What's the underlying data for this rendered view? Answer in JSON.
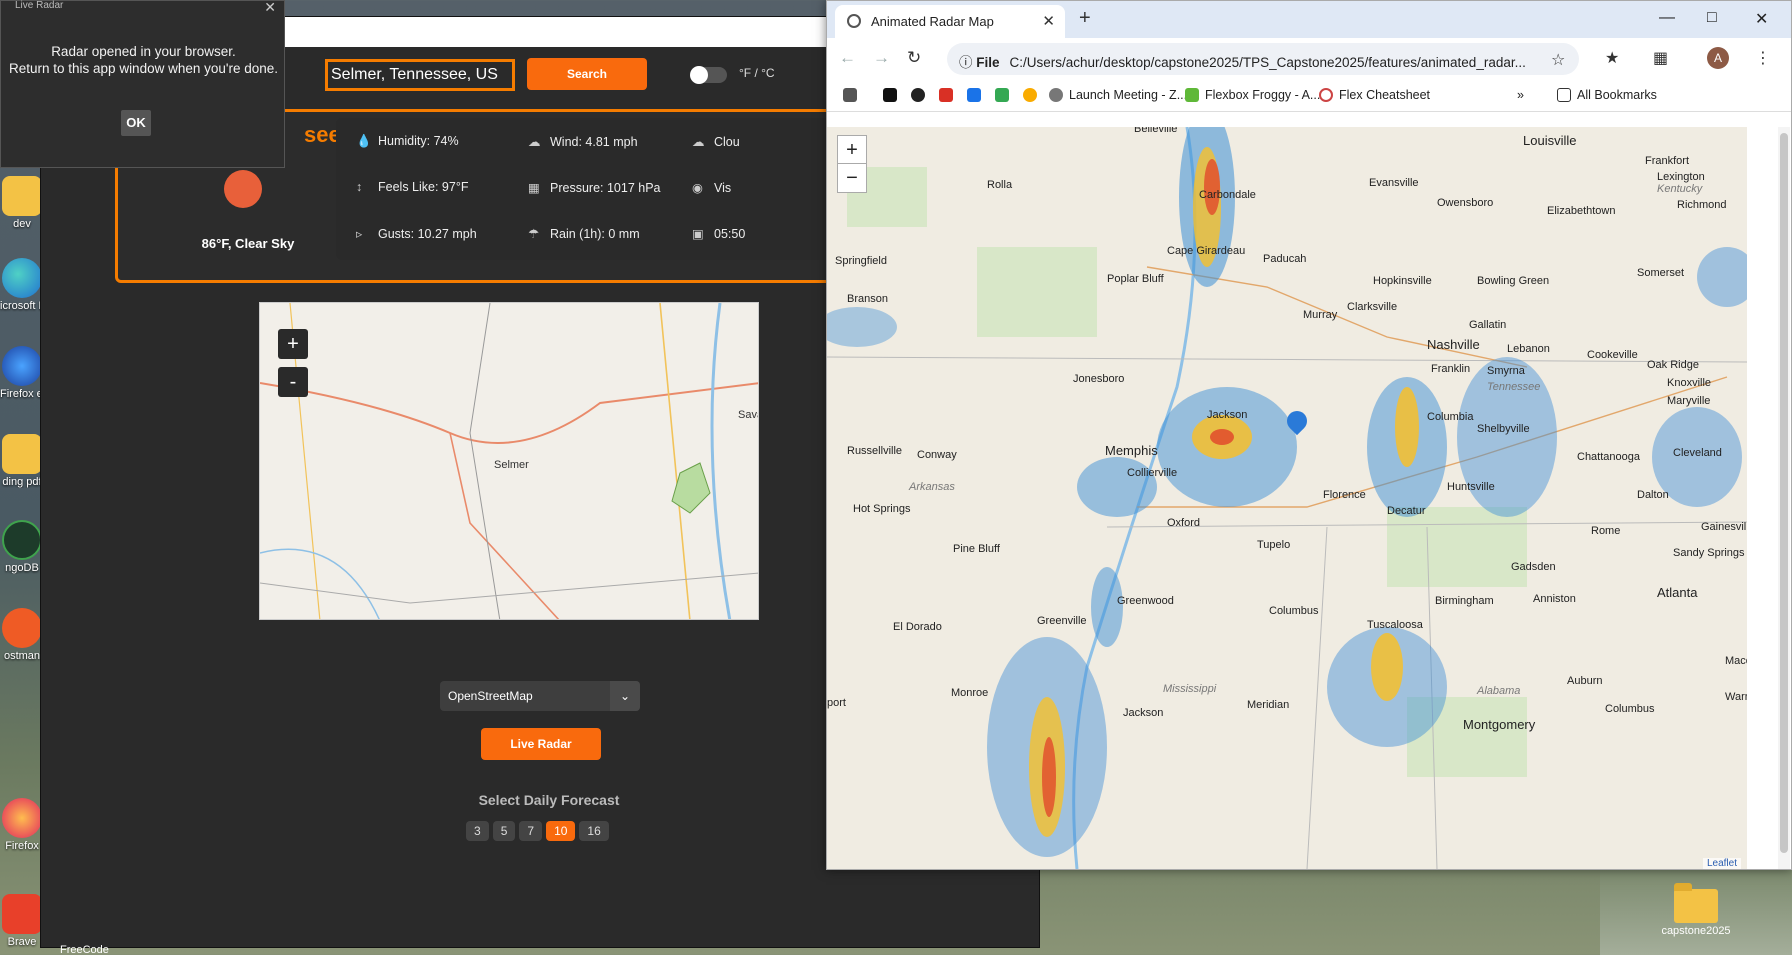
{
  "desktop": {
    "icons": [
      {
        "label": "dev"
      },
      {
        "label": "icrosoft Edge"
      },
      {
        "label": "Firefox evelop..."
      },
      {
        "label": "ding pdf"
      },
      {
        "label": "ngoDB"
      },
      {
        "label": "ostman"
      },
      {
        "label": "Firefox"
      },
      {
        "label": "Brave"
      }
    ],
    "taskbar_label": "FreeCode",
    "folder_label": "capstone2025"
  },
  "dialog": {
    "title": "Live Radar",
    "message_line1": "Radar opened in your browser.",
    "message_line2": "Return to this app window when you're done.",
    "ok_label": "OK"
  },
  "app": {
    "search_value": "Selmer, Tennessee, US",
    "search_button": "Search",
    "unit_toggle_label": "°F / °C",
    "city_name": "see, US",
    "temp_summary": "86°F, Clear Sky",
    "details": {
      "humidity": "Humidity: 74%",
      "wind": "Wind: 4.81 mph",
      "clouds": "Clou",
      "feels_like": "Feels Like: 97°F",
      "pressure": "Pressure: 1017 hPa",
      "visibility": "Vis",
      "gusts": "Gusts: 10.27 mph",
      "rain": "Rain (1h): 0 mm",
      "time": "05:50"
    },
    "map": {
      "zoom_in": "+",
      "zoom_out": "-",
      "labels": {
        "selmer": "Selmer",
        "sava": "Sava"
      }
    },
    "layer_select": "OpenStreetMap",
    "radar_button": "Live Radar",
    "forecast_title": "Select Daily Forecast",
    "forecast_days": [
      "3",
      "5",
      "7",
      "10",
      "16"
    ],
    "forecast_active": "10"
  },
  "browser": {
    "tab_title": "Animated Radar Map",
    "url_scheme": "File",
    "url": "C:/Users/achur/desktop/capstone2025/TPS_Capstone2025/features/animated_radar...",
    "avatar_letter": "A",
    "bookmarks": {
      "launch": "Launch Meeting - Z...",
      "flexbox": "Flexbox Froggy - A...",
      "flex": "Flex Cheatsheet",
      "all": "All Bookmarks"
    },
    "radar_map": {
      "zoom_in": "+",
      "zoom_out": "−",
      "attribution": "Leaflet",
      "cities": {
        "belleville": "Belleville",
        "louisville": "Louisville",
        "frankfort": "Frankfort",
        "lexington": "Lexington",
        "rolla": "Rolla",
        "carbondale": "Carbondale",
        "evansville": "Evansville",
        "owensboro": "Owensboro",
        "elizabethtown": "Elizabethtown",
        "richmond": "Richmond",
        "springfield": "Springfield",
        "capegirardeau": "Cape Girardeau",
        "paducah": "Paducah",
        "poplarbluff": "Poplar Bluff",
        "hopkinsville": "Hopkinsville",
        "bowlinggreen": "Bowling Green",
        "somerset": "Somerset",
        "branson": "Branson",
        "clarksville": "Clarksville",
        "murray": "Murray",
        "gallatin": "Gallatin",
        "nashville": "Nashville",
        "lebanon": "Lebanon",
        "cookeville": "Cookeville",
        "jonesboro": "Jonesboro",
        "franklin": "Franklin",
        "smyrna": "Smyrna",
        "oakridge": "Oak Ridge",
        "knoxville": "Knoxville",
        "maryville": "Maryville",
        "jackson_tn": "Jackson",
        "columbia": "Columbia",
        "shelbyville": "Shelbyville",
        "russellville": "Russellville",
        "conway": "Conway",
        "memphis": "Memphis",
        "collierville": "Collierville",
        "cleveland": "Cleveland",
        "chattanooga": "Chattanooga",
        "huntsville": "Huntsville",
        "florence": "Florence",
        "decatur": "Decatur",
        "dalton": "Dalton",
        "hotsprings": "Hot Springs",
        "oxford": "Oxford",
        "rome": "Rome",
        "gainesville": "Gainesville",
        "tupelo": "Tupelo",
        "pinebluff": "Pine Bluff",
        "sandysprings": "Sandy Springs",
        "gadsden": "Gadsden",
        "atlanta": "Atlanta",
        "greenwood": "Greenwood",
        "birmingham": "Birmingham",
        "anniston": "Anniston",
        "columbus_ms": "Columbus",
        "eldorado": "El Dorado",
        "greenville": "Greenville",
        "tuscaloosa": "Tuscaloosa",
        "macon": "Maco",
        "monroe": "Monroe",
        "auburn": "Auburn",
        "warner": "Warn",
        "meridian": "Meridian",
        "columbus_ga": "Columbus",
        "jackson_ms": "Jackson",
        "montgomery": "Montgomery",
        "port": "port"
      },
      "states": {
        "kentucky": "Kentucky",
        "tennessee": "Tennessee",
        "arkansas": "Arkansas",
        "mississippi": "Mississippi",
        "alabama": "Alabama"
      }
    }
  },
  "colors": {
    "accent": "#f57c00",
    "button": "#f96a0d",
    "app_bg": "#2a2a2a",
    "radar_rain": "#3d8fd6",
    "radar_heavy": "#f6c02c",
    "radar_storm": "#e14a2b"
  }
}
